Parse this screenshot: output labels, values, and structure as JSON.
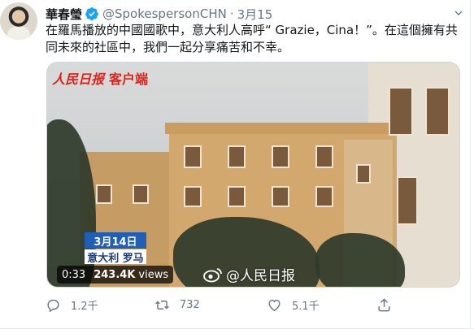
{
  "tweet": {
    "author": {
      "display_name": "華春瑩",
      "verified_icon": "verified-badge-icon",
      "handle": "@SpokespersonCHN",
      "separator": "·",
      "time": "3月15"
    },
    "text": "在羅馬播放的中國國歌中，意大利人高呼“ Grazie，Cina！”。在這個擁有共同未來的社區中，我們一起分享痛苦和不幸。",
    "media": {
      "broadcaster_logo": "人民日报",
      "broadcaster_sub": "客户端",
      "date_badge": "3月14日",
      "place_badge": "意大利 罗马",
      "watermark_text": "@人民日报",
      "duration": "0:33",
      "views_count": "243.4K",
      "views_word": "views"
    },
    "actions": {
      "reply_count": "1.2千",
      "retweet_count": "732",
      "like_count": "5.1千"
    }
  },
  "colors": {
    "text_primary": "#14171a",
    "text_secondary": "#657786",
    "verified_blue": "#1da1f2",
    "badge_blue": "#1f5fb8",
    "logo_red": "#e0231c"
  }
}
